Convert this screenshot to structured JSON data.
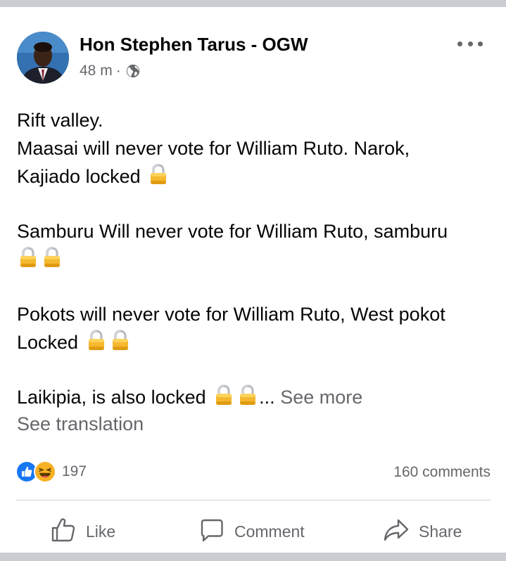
{
  "post": {
    "author": "Hon Stephen Tarus - OGW",
    "time": "48 m",
    "separator": "·",
    "privacy_icon": "globe-icon",
    "more_icon": "more-options-icon",
    "paragraphs": [
      {
        "lines": [
          "Rift valley.",
          "Maasai will never vote for William Ruto. Narok,",
          "Kajiado locked"
        ],
        "locks": 1
      },
      {
        "lines": [
          "Samburu Will never vote for William Ruto, samburu"
        ],
        "locks": 2
      },
      {
        "lines": [
          "Pokots will never vote for William Ruto, West pokot",
          "Locked"
        ],
        "locks": 2
      },
      {
        "lines": [
          "Laikipia, is also locked"
        ],
        "locks": 2
      }
    ],
    "ellipsis": "...",
    "see_more": "See more",
    "see_translation": "See translation",
    "reaction_icons": [
      "like-reaction-icon",
      "haha-reaction-icon"
    ],
    "reaction_count": "197",
    "comments_count": "160 comments"
  },
  "actions": {
    "like": "Like",
    "comment": "Comment",
    "share": "Share"
  },
  "colors": {
    "text": "#050505",
    "secondary": "#65676b",
    "like_blue": "#1877f2",
    "haha_yellow": "#f7b125",
    "page_bg": "#c9ccd1"
  }
}
